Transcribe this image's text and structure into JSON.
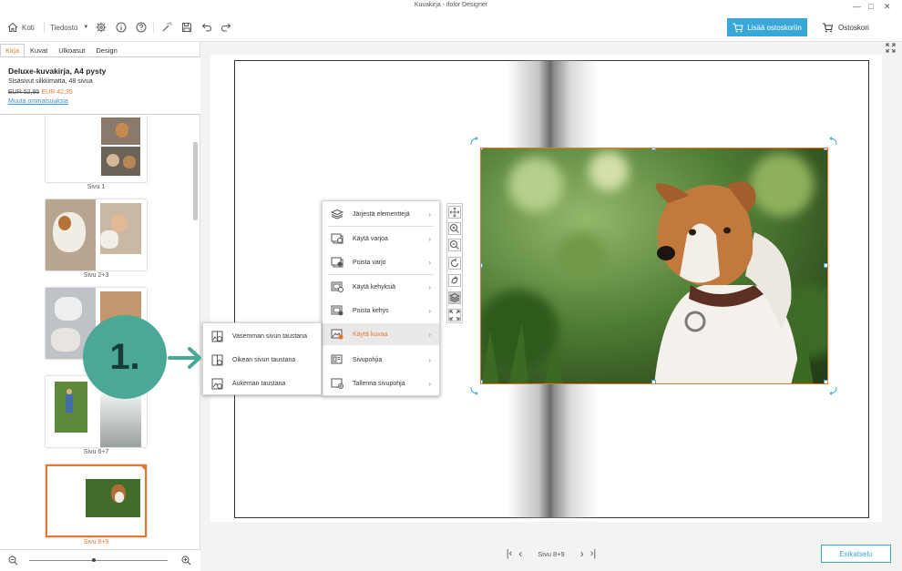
{
  "window": {
    "title": "Kuvakirja - ifolor Designer",
    "minimize": "—",
    "maximize": "□",
    "close": "✕"
  },
  "toolbar": {
    "home_label": "Koti",
    "file_label": "Tiedosto",
    "add_to_cart_label": "Lisää ostoskoriin",
    "cart_label": "Ostoskori"
  },
  "left_tabs": [
    {
      "label": "Kirja",
      "active": true
    },
    {
      "label": "Kuvat",
      "active": false
    },
    {
      "label": "Ulkoasut",
      "active": false
    },
    {
      "label": "Design",
      "active": false
    }
  ],
  "product": {
    "name": "Deluxe-kuvakirja, A4 pysty",
    "subtitle": "Sisäsivut silkkimatta, 48 sivua",
    "old_price": "EUR 52,95",
    "new_price": "EUR 42,35",
    "change_link": "Muuta ominaisuuksia"
  },
  "pages": [
    {
      "label": "Sivu 1"
    },
    {
      "label": "Sivu 2+3"
    },
    {
      "label": ""
    },
    {
      "label": "Sivu 6+7"
    },
    {
      "label": "Sivu 8+9",
      "selected": true
    }
  ],
  "context_menu": {
    "items": [
      {
        "label": "Järjestä elementtejä",
        "icon": "layers-icon"
      },
      {
        "label": "Käytä varjoa",
        "icon": "shadow-icon"
      },
      {
        "label": "Poista varjo",
        "icon": "remove-shadow-icon"
      },
      {
        "label": "Käytä kehyksiä",
        "icon": "frame-icon"
      },
      {
        "label": "Poista kehys",
        "icon": "remove-frame-icon"
      },
      {
        "label": "Käytä kuvaa",
        "icon": "use-image-icon",
        "highlighted": true
      },
      {
        "label": "Sivupohjia",
        "icon": "template-icon"
      },
      {
        "label": "Tallenna sivupohja",
        "icon": "save-template-icon"
      }
    ]
  },
  "submenu": {
    "items": [
      {
        "label": "Vasemman sivun taustana"
      },
      {
        "label": "Oikean sivun taustana"
      },
      {
        "label": "Aukeman taustana"
      }
    ]
  },
  "annotation": {
    "step": "1."
  },
  "navigation": {
    "page_label": "Sivu 8+9",
    "preview_label": "Esikatselu"
  },
  "colors": {
    "accent": "#e8772e",
    "primary": "#3aa7d9",
    "annotation": "#4aa894"
  }
}
